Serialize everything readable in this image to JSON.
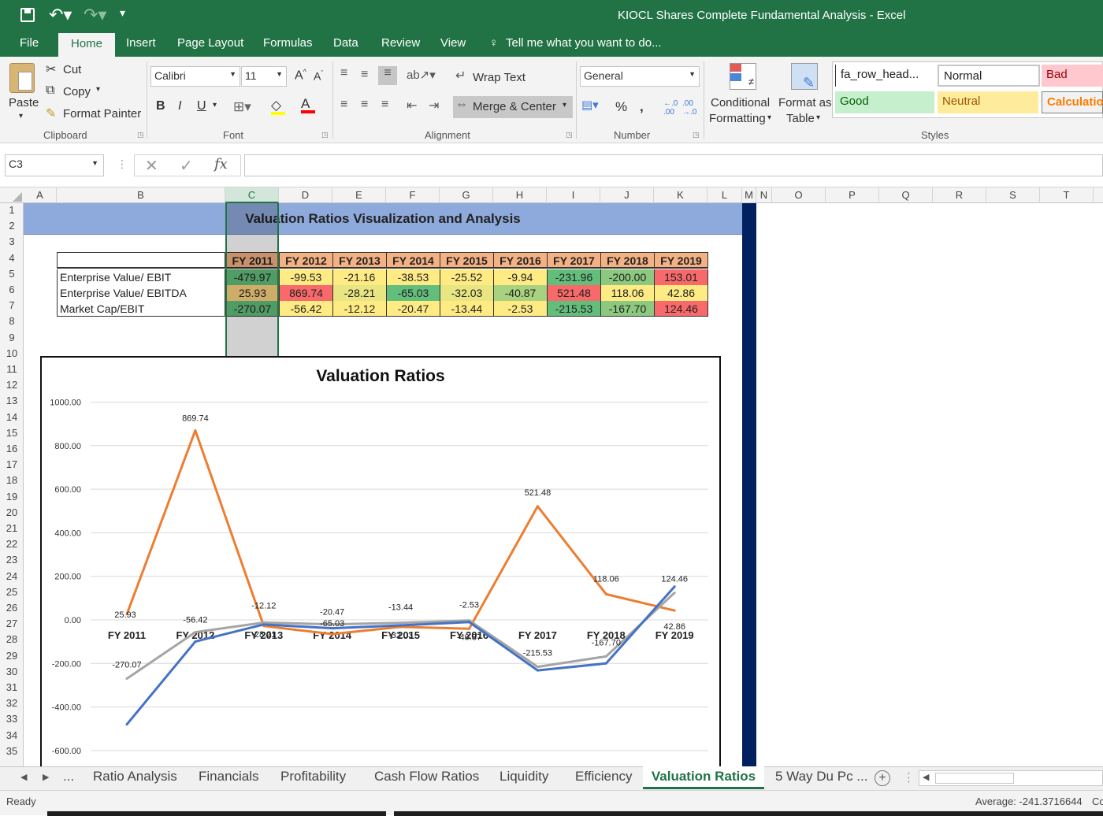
{
  "window": {
    "title": "KIOCL Shares Complete Fundamental Analysis - Excel"
  },
  "tabs": [
    "File",
    "Home",
    "Insert",
    "Page Layout",
    "Formulas",
    "Data",
    "Review",
    "View"
  ],
  "tell_me": "Tell me what you want to do...",
  "ribbon": {
    "clipboard": {
      "paste": "Paste",
      "cut": "Cut",
      "copy": "Copy",
      "format_painter": "Format Painter",
      "group": "Clipboard"
    },
    "font": {
      "name": "Calibri",
      "size": "11",
      "bold": "B",
      "italic": "I",
      "underline": "U",
      "group": "Font"
    },
    "alignment": {
      "wrap": "Wrap Text",
      "merge": "Merge & Center",
      "group": "Alignment"
    },
    "number": {
      "format": "General",
      "percent": "%",
      "comma": ",",
      "group": "Number"
    },
    "styles": {
      "conditional": "Conditional",
      "conditional2": "Formatting",
      "format_as": "Format as",
      "format_as2": "Table",
      "fa_row": "fa_row_head...",
      "normal": "Normal",
      "bad": "Bad",
      "good": "Good",
      "neutral": "Neutral",
      "calculation": "Calculatio",
      "group": "Styles"
    }
  },
  "formula_bar": {
    "name_box": "C3",
    "fx": "fx",
    "content": ""
  },
  "columns": [
    "A",
    "B",
    "C",
    "D",
    "E",
    "F",
    "G",
    "H",
    "I",
    "J",
    "K",
    "L",
    "M",
    "N",
    "O",
    "P",
    "Q",
    "R",
    "S",
    "T"
  ],
  "rows": [
    "1",
    "2",
    "3",
    "4",
    "5",
    "6",
    "7",
    "8",
    "9",
    "10",
    "11",
    "12",
    "13",
    "14",
    "15",
    "16",
    "17",
    "18",
    "19",
    "20",
    "21",
    "22",
    "23",
    "24",
    "25",
    "26",
    "27",
    "28",
    "29",
    "30",
    "31",
    "32",
    "33",
    "34",
    "35"
  ],
  "sheet_title": "Valuation Ratios Visualization and Analysis",
  "table": {
    "headers": [
      "FY 2011",
      "FY 2012",
      "FY 2013",
      "FY 2014",
      "FY 2015",
      "FY 2016",
      "FY 2017",
      "FY 2018",
      "FY 2019"
    ],
    "rows": [
      {
        "label": "Enterprise Value/ EBIT",
        "values": [
          "-479.97",
          "-99.53",
          "-21.16",
          "-38.53",
          "-25.52",
          "-9.94",
          "-231.96",
          "-200.00",
          "153.01"
        ],
        "colors": [
          "#63be7b",
          "#ffeb84",
          "#ffeb84",
          "#ffeb84",
          "#ffeb84",
          "#ffeb84",
          "#63be7b",
          "#8cc87f",
          "#f8696b"
        ]
      },
      {
        "label": "Enterprise Value/ EBITDA",
        "values": [
          "25.93",
          "869.74",
          "-28.21",
          "-65.03",
          "-32.03",
          "-40.87",
          "521.48",
          "118.06",
          "42.86"
        ],
        "colors": [
          "#fcd380",
          "#f8696b",
          "#e8e583",
          "#63be7b",
          "#e8e583",
          "#a8d27f",
          "#f8696b",
          "#ffeb84",
          "#ffeb84"
        ]
      },
      {
        "label": "Market Cap/EBIT",
        "values": [
          "-270.07",
          "-56.42",
          "-12.12",
          "-20.47",
          "-13.44",
          "-2.53",
          "-215.53",
          "-167.70",
          "124.46"
        ],
        "colors": [
          "#63be7b",
          "#ffeb84",
          "#ffeb84",
          "#ffeb84",
          "#ffeb84",
          "#ffeb84",
          "#63be7b",
          "#8cc87f",
          "#f8696b"
        ]
      }
    ]
  },
  "chart_data": {
    "type": "line",
    "title": "Valuation Ratios",
    "categories": [
      "FY 2011",
      "FY 2012",
      "FY 2013",
      "FY 2014",
      "FY 2015",
      "FY 2016",
      "FY 2017",
      "FY 2018",
      "FY 2019"
    ],
    "series": [
      {
        "name": "Enterprise Value/ EBIT",
        "color": "#4472c4",
        "values": [
          -479.97,
          -99.53,
          -21.16,
          -38.53,
          -25.52,
          -9.94,
          -231.96,
          -200.0,
          153.01
        ]
      },
      {
        "name": "Enterprise Value/ EBITDA",
        "color": "#ed7d31",
        "values": [
          25.93,
          869.74,
          -28.21,
          -65.03,
          -32.03,
          -40.87,
          521.48,
          118.06,
          42.86
        ]
      },
      {
        "name": "Market Cap/EBIT",
        "color": "#a5a5a5",
        "values": [
          -270.07,
          -56.42,
          -12.12,
          -20.47,
          -13.44,
          -2.53,
          -215.53,
          -167.7,
          124.46
        ]
      }
    ],
    "labeled_series": [
      1,
      2
    ],
    "yticks": [
      "1000.00",
      "800.00",
      "600.00",
      "400.00",
      "200.00",
      "0.00",
      "-200.00",
      "-400.00",
      "-600.00"
    ],
    "grid": true
  },
  "sheet_tabs": [
    "Ratio Analysis",
    "Financials",
    "Profitability",
    "Cash Flow Ratios",
    "Liquidity",
    "Efficiency",
    "Valuation Ratios",
    "5 Way Du Pc ..."
  ],
  "active_sheet": "Valuation Ratios",
  "status": {
    "ready": "Ready",
    "average": "Average: -241.3716644",
    "cut": "Co"
  }
}
